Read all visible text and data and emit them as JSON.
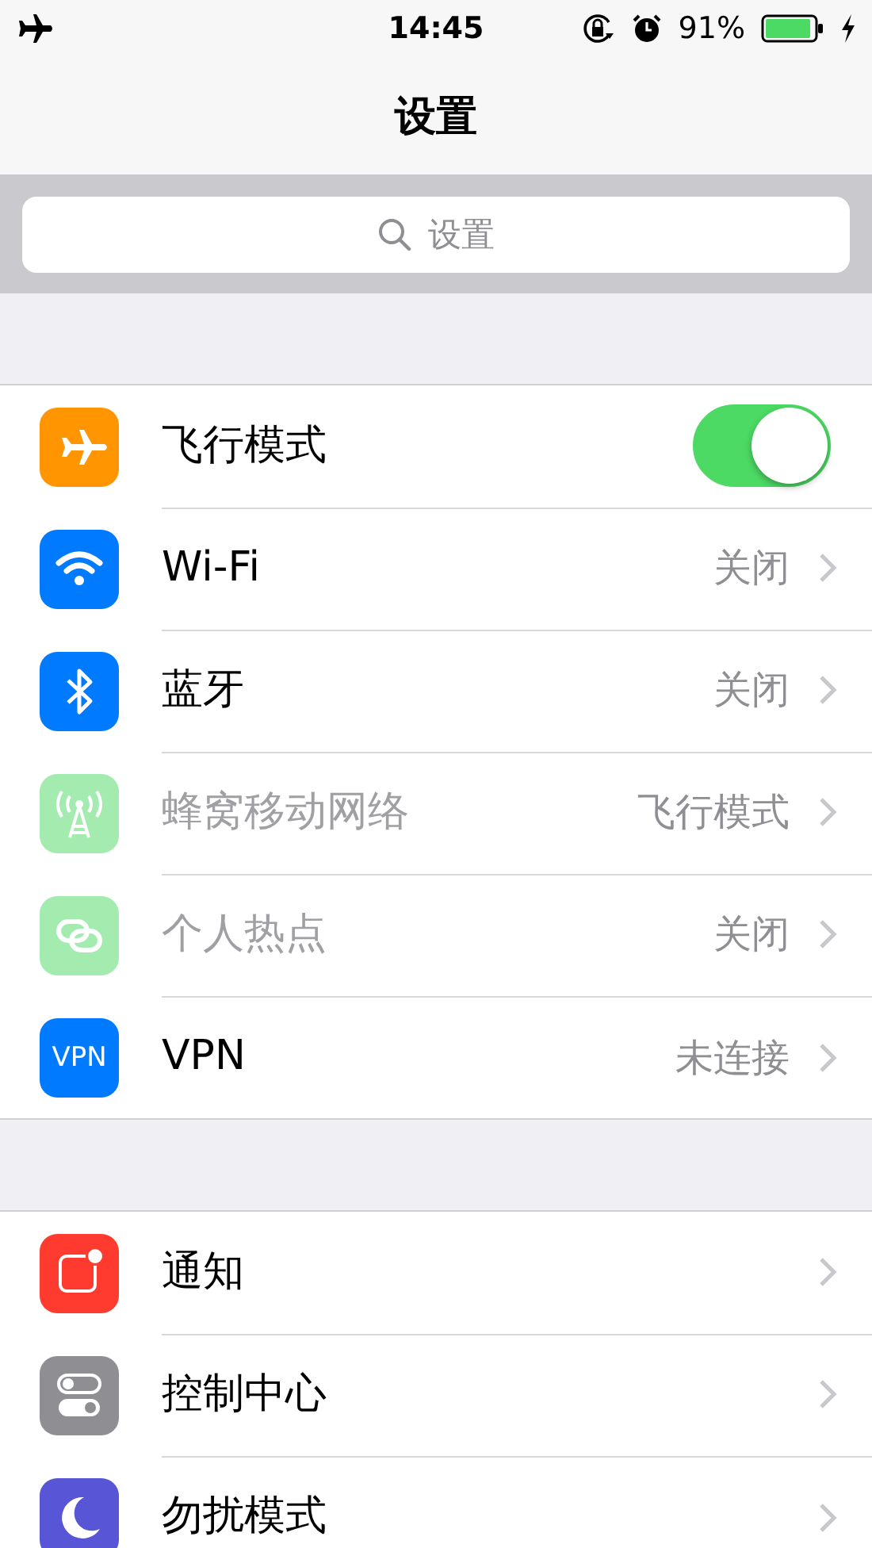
{
  "status_bar": {
    "time": "14:45",
    "battery": "91%"
  },
  "nav": {
    "title": "设置"
  },
  "search": {
    "placeholder": "设置"
  },
  "groups": [
    {
      "rows": [
        {
          "kind": "toggle",
          "label": "飞行模式",
          "on": true,
          "disabled": false
        },
        {
          "kind": "link",
          "label": "Wi-Fi",
          "value": "关闭",
          "disabled": false
        },
        {
          "kind": "link",
          "label": "蓝牙",
          "value": "关闭",
          "disabled": false
        },
        {
          "kind": "link",
          "label": "蜂窝移动网络",
          "value": "飞行模式",
          "disabled": true
        },
        {
          "kind": "link",
          "label": "个人热点",
          "value": "关闭",
          "disabled": true
        },
        {
          "kind": "link",
          "label": "VPN",
          "value": "未连接",
          "disabled": false,
          "icon_text": "VPN"
        }
      ]
    },
    {
      "rows": [
        {
          "kind": "link",
          "label": "通知",
          "disabled": false
        },
        {
          "kind": "link",
          "label": "控制中心",
          "disabled": false
        },
        {
          "kind": "link",
          "label": "勿扰模式",
          "disabled": false
        }
      ]
    }
  ]
}
